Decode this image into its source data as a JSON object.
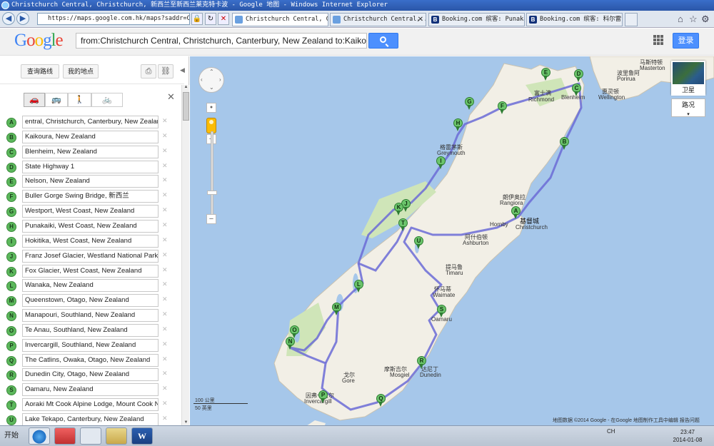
{
  "window": {
    "title": "Christchurch Central, Christchurch, 新西兰至新西兰莱克特卡波 - Google 地图 - Windows Internet Explorer"
  },
  "browser": {
    "address": "https://maps.google.com.hk/maps?saddr=Chr",
    "tabs": [
      {
        "label": "Christchurch Central, Ch..."
      },
      {
        "label": "Christchurch Central,..."
      },
      {
        "label": "Booking.com 缤客: Punaka..."
      },
      {
        "label": "Booking.com 缤客: 科尔雷..."
      }
    ]
  },
  "google": {
    "logo": "Google",
    "search_value": "from:Christchurch Central, Christchurch, Canterbury, New Zealand to:Kaikoura, N",
    "login_label": "登录"
  },
  "panel": {
    "get_directions": "查询路线",
    "my_places": "我的地点",
    "waypoints": [
      {
        "letter": "A",
        "text": "entral, Christchurch, Canterbury, New Zealand"
      },
      {
        "letter": "B",
        "text": "Kaikoura, New Zealand"
      },
      {
        "letter": "C",
        "text": "Blenheim, New Zealand"
      },
      {
        "letter": "D",
        "text": "State Highway 1"
      },
      {
        "letter": "E",
        "text": "Nelson, New Zealand"
      },
      {
        "letter": "F",
        "text": "Buller Gorge Swing Bridge, 新西兰"
      },
      {
        "letter": "G",
        "text": "Westport, West Coast, New Zealand"
      },
      {
        "letter": "H",
        "text": "Punakaiki, West Coast, New Zealand"
      },
      {
        "letter": "I",
        "text": "Hokitika, West Coast, New Zealand"
      },
      {
        "letter": "J",
        "text": "Franz Josef Glacier, Westland National Park, W"
      },
      {
        "letter": "K",
        "text": "Fox Glacier, West Coast, New Zealand"
      },
      {
        "letter": "L",
        "text": "Wanaka, New Zealand"
      },
      {
        "letter": "M",
        "text": "Queenstown, Otago, New Zealand"
      },
      {
        "letter": "N",
        "text": "Manapouri, Southland, New Zealand"
      },
      {
        "letter": "O",
        "text": "Te Anau, Southland, New Zealand"
      },
      {
        "letter": "P",
        "text": "Invercargill, Southland, New Zealand"
      },
      {
        "letter": "Q",
        "text": "The Catlins, Owaka, Otago, New Zealand"
      },
      {
        "letter": "R",
        "text": "Dunedin City, Otago, New Zealand"
      },
      {
        "letter": "S",
        "text": "Oamaru, New Zealand"
      },
      {
        "letter": "T",
        "text": "Aoraki Mt Cook Alpine Lodge, Mount Cook Na"
      },
      {
        "letter": "U",
        "text": "Lake Tekapo, Canterbury, New Zealand"
      }
    ]
  },
  "map": {
    "satellite_label": "卫星",
    "road_label": "路况",
    "scale_metric": "100 公里",
    "scale_imperial": "50 英里",
    "footer": "地图数据 ©2014 Google -   在Google 地图制作工具中编辑   报告问题",
    "pins": [
      "A",
      "B",
      "C",
      "D",
      "E",
      "F",
      "G",
      "H",
      "I",
      "J",
      "K",
      "L",
      "M",
      "N",
      "O",
      "P",
      "Q",
      "R",
      "S",
      "T",
      "U"
    ],
    "places": [
      {
        "text": "惠灵顿"
      },
      {
        "text": "Wellington"
      },
      {
        "text": "波里鲁阿"
      },
      {
        "text": "Porirua"
      },
      {
        "text": "马斯特顿"
      },
      {
        "text": "Masterton"
      },
      {
        "text": "富士满"
      },
      {
        "text": "Richmond"
      },
      {
        "text": "Blenheim"
      },
      {
        "text": "格雷茅斯"
      },
      {
        "text": "Greymouth"
      },
      {
        "text": "朗伊奥拉"
      },
      {
        "text": "Rangiora"
      },
      {
        "text": "基督城"
      },
      {
        "text": "Christchurch"
      },
      {
        "text": "Hornby"
      },
      {
        "text": "阿什伯顿"
      },
      {
        "text": "Ashburton"
      },
      {
        "text": "提马鲁"
      },
      {
        "text": "Timaru"
      },
      {
        "text": "怀马蒂"
      },
      {
        "text": "Waimate"
      },
      {
        "text": "Oamaru"
      },
      {
        "text": "摩斯吉尔"
      },
      {
        "text": "Mosgiel"
      },
      {
        "text": "达尼丁"
      },
      {
        "text": "Dunedin"
      },
      {
        "text": "戈尔"
      },
      {
        "text": "Gore"
      },
      {
        "text": "因弗卡吉尔"
      },
      {
        "text": "Invercargill"
      }
    ]
  },
  "taskbar": {
    "start": "开始",
    "lang": "CH",
    "time": "23:47",
    "date": "2014-01-08"
  },
  "colors": {
    "water": "#a6c7ea",
    "land": "#f2efe6",
    "park": "#cfe5b8",
    "route": "#6b6bd6",
    "pin": "#6bc46b",
    "accent": "#4d90fe"
  }
}
